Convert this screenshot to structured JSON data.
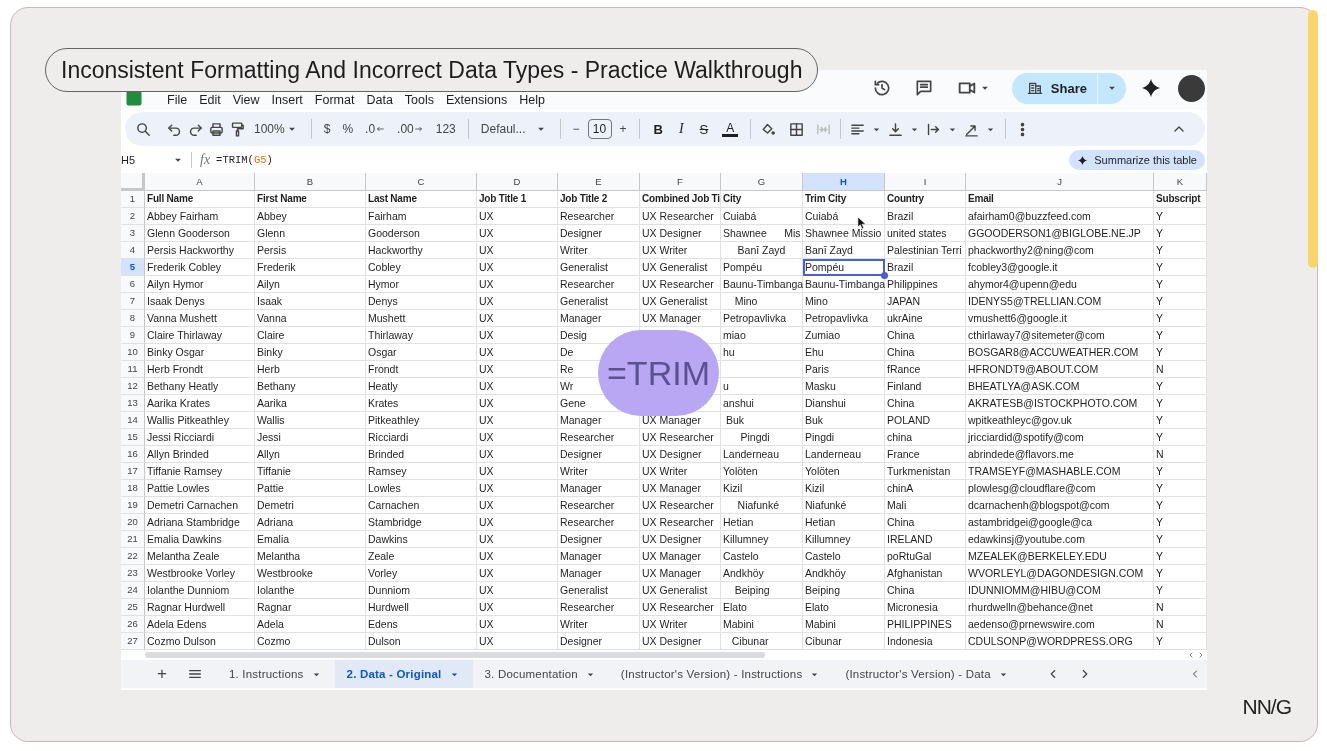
{
  "video_title": "Inconsistent Formatting And Incorrect Data Types - Practice Walkthrough",
  "menu": [
    "File",
    "Edit",
    "View",
    "Insert",
    "Format",
    "Data",
    "Tools",
    "Extensions",
    "Help"
  ],
  "share_button": "Share",
  "toolbar": {
    "zoom": "100%",
    "currency": "$",
    "percent": "%",
    "decrease_decimal": ".0",
    "increase_decimal": ".00",
    "number_format": "123",
    "font": "Defaul...",
    "minus": "−",
    "font_size": "10",
    "plus": "+",
    "bold": "B",
    "italic": "I",
    "strikethrough": "S",
    "text_color": "A"
  },
  "formula_bar": {
    "cell_ref": "H5",
    "fx": "fx",
    "formula": [
      {
        "text": "=TRIM(",
        "kind": "text"
      },
      {
        "text": "G5",
        "kind": "ref"
      },
      {
        "text": ")",
        "kind": "text"
      }
    ]
  },
  "summarize_button": "Summarize this table",
  "grid": {
    "columns": [
      {
        "letter": "A",
        "selected": false
      },
      {
        "letter": "B",
        "selected": false
      },
      {
        "letter": "C",
        "selected": false
      },
      {
        "letter": "D",
        "selected": false
      },
      {
        "letter": "E",
        "selected": false
      },
      {
        "letter": "F",
        "selected": false
      },
      {
        "letter": "G",
        "selected": false
      },
      {
        "letter": "H",
        "selected": true
      },
      {
        "letter": "I",
        "selected": false
      },
      {
        "letter": "J",
        "selected": false
      },
      {
        "letter": "K",
        "selected": false
      }
    ],
    "rows": [
      {
        "number": "1",
        "kind": "header",
        "selected": false,
        "cells": [
          "Full Name",
          "First Name",
          "Last Name",
          "Job Title 1",
          "Job Title 2",
          "Combined Job Ti",
          "City",
          "Trim City",
          "Country",
          "Email",
          "Subscript"
        ]
      },
      {
        "number": "2",
        "kind": "data",
        "selected": false,
        "cells": [
          "Abbey Fairham",
          "Abbey",
          "Fairham",
          "UX",
          "Researcher",
          "UX Researcher",
          "Cuiabá",
          "Cuiabá",
          "Brazil",
          "afairham0@buzzfeed.com",
          "Y"
        ]
      },
      {
        "number": "3",
        "kind": "data",
        "selected": false,
        "cells": [
          "Glenn Gooderson",
          "Glenn",
          "Gooderson",
          "UX",
          "Designer",
          "UX Designer",
          "Shawnee      Mis",
          "Shawnee Missio",
          "united states",
          "GGOODERSON1@BIGLOBE.NE.JP",
          "Y"
        ]
      },
      {
        "number": "4",
        "kind": "data",
        "selected": false,
        "cells": [
          "Persis Hackworthy",
          "Persis",
          "Hackworthy",
          "UX",
          "Writer",
          "UX Writer",
          "     Banī Zayd",
          "Banī Zayd",
          "Palestinian Terri",
          "phackworthy2@ning@com",
          "Y"
        ]
      },
      {
        "number": "5",
        "kind": "data",
        "selected": true,
        "cells": [
          "Frederik Cobley",
          "Frederik",
          "Cobley",
          "UX",
          "Generalist",
          "UX Generalist",
          "Pompéu",
          "Pompéu",
          "Brazil",
          "fcobley3@google.it",
          "Y"
        ]
      },
      {
        "number": "6",
        "kind": "data",
        "selected": false,
        "cells": [
          "Ailyn Hymor",
          "Ailyn",
          "Hymor",
          "UX",
          "Researcher",
          "UX Researcher",
          "Baunu-Timbanga",
          "Baunu-Timbanga",
          "Philippines",
          "ahymor4@upenn@edu",
          "Y"
        ]
      },
      {
        "number": "7",
        "kind": "data",
        "selected": false,
        "cells": [
          "Isaak Denys",
          "Isaak",
          "Denys",
          "UX",
          "Generalist",
          "UX Generalist",
          "    Mino",
          "Mino",
          "JAPAN",
          "IDENYS5@TRELLIAN.COM",
          "Y"
        ]
      },
      {
        "number": "8",
        "kind": "data",
        "selected": false,
        "cells": [
          "Vanna Mushett",
          "Vanna",
          "Mushett",
          "UX",
          "Manager",
          "UX Manager",
          "Petropavlivka",
          "Petropavlivka",
          "ukrAine",
          "vmushett6@google.it",
          "Y"
        ]
      },
      {
        "number": "9",
        "kind": "data",
        "selected": false,
        "cells": [
          "Claire Thirlaway",
          "Claire",
          "Thirlaway",
          "UX",
          "Desig",
          null,
          "miao",
          "Zumiao",
          "China",
          "cthirlaway7@sitemeter@com",
          "Y"
        ]
      },
      {
        "number": "10",
        "kind": "data",
        "selected": false,
        "cells": [
          "Binky Osgar",
          "Binky",
          "Osgar",
          "UX",
          "De",
          null,
          "hu",
          "Ehu",
          "China",
          "BOSGAR8@ACCUWEATHER.COM",
          "Y"
        ]
      },
      {
        "number": "11",
        "kind": "data",
        "selected": false,
        "cells": [
          "Herb Frondt",
          "Herb",
          "Frondt",
          "UX",
          "Re",
          null,
          null,
          "Paris",
          "fRance",
          "HFRONDT9@ABOUT.COM",
          "N"
        ]
      },
      {
        "number": "12",
        "kind": "data",
        "selected": false,
        "cells": [
          "Bethany Heatly",
          "Bethany",
          "Heatly",
          "UX",
          "Wr",
          null,
          "u",
          "Masku",
          "Finland",
          "BHEATLYA@ASK.COM",
          "Y"
        ]
      },
      {
        "number": "13",
        "kind": "data",
        "selected": false,
        "cells": [
          "Aarika Krates",
          "Aarika",
          "Krates",
          "UX",
          "Gene",
          null,
          "anshui",
          "Dianshui",
          "China",
          "AKRATESB@ISTOCKPHOTO.COM",
          "Y"
        ]
      },
      {
        "number": "14",
        "kind": "data",
        "selected": false,
        "cells": [
          "Wallis Pitkeathley",
          "Wallis",
          "Pitkeathley",
          "UX",
          "Manager",
          "UX Manager",
          " Buk",
          "Buk",
          "POLAND",
          "wpitkeathleyc@gov.uk",
          "Y"
        ]
      },
      {
        "number": "15",
        "kind": "data",
        "selected": false,
        "cells": [
          "Jessi Ricciardi",
          "Jessi",
          "Ricciardi",
          "UX",
          "Researcher",
          "UX Researcher",
          "      Pingdi",
          "Pingdi",
          "china",
          "jricciardid@spotify@com",
          "Y"
        ]
      },
      {
        "number": "16",
        "kind": "data",
        "selected": false,
        "cells": [
          "Allyn Brinded",
          "Allyn",
          "Brinded",
          "UX",
          "Designer",
          "UX Designer",
          "Landerneau",
          "Landerneau",
          "France",
          "abrindede@flavors.me",
          "N"
        ]
      },
      {
        "number": "17",
        "kind": "data",
        "selected": false,
        "cells": [
          "Tiffanie Ramsey",
          "Tiffanie",
          "Ramsey",
          "UX",
          "Writer",
          "UX Writer",
          "Yolöten",
          "Yolöten",
          "Turkmenistan",
          "TRAMSEYF@MASHABLE.COM",
          "Y"
        ]
      },
      {
        "number": "18",
        "kind": "data",
        "selected": false,
        "cells": [
          "Pattie Lowles",
          "Pattie",
          "Lowles",
          "UX",
          "Manager",
          "UX Manager",
          "Kizil",
          "Kizil",
          "chinA",
          "plowlesg@cloudflare@com",
          "Y"
        ]
      },
      {
        "number": "19",
        "kind": "data",
        "selected": false,
        "cells": [
          "Demetri Carnachen",
          "Demetri",
          "Carnachen",
          "UX",
          "Researcher",
          "UX Researcher",
          "     Niafunké",
          "Niafunké",
          "Mali",
          "dcarnachenh@blogspot@com",
          "Y"
        ]
      },
      {
        "number": "20",
        "kind": "data",
        "selected": false,
        "cells": [
          "Adriana Stambridge",
          "Adriana",
          "Stambridge",
          "UX",
          "Researcher",
          "UX Researcher",
          "Hetian",
          "Hetian",
          "China",
          "astambridgei@google@ca",
          "Y"
        ]
      },
      {
        "number": "21",
        "kind": "data",
        "selected": false,
        "cells": [
          "Emalia Dawkins",
          "Emalia",
          "Dawkins",
          "UX",
          "Designer",
          "UX Designer",
          "Killumney",
          "Killumney",
          "IRELAND",
          "edawkinsj@youtube.com",
          "Y"
        ]
      },
      {
        "number": "22",
        "kind": "data",
        "selected": false,
        "cells": [
          "Melantha Zeale",
          "Melantha",
          "Zeale",
          "UX",
          "Manager",
          "UX Manager",
          "Castelo",
          "Castelo",
          "poRtuGal",
          "MZEALEK@BERKELEY.EDU",
          "Y"
        ]
      },
      {
        "number": "23",
        "kind": "data",
        "selected": false,
        "cells": [
          "Westbrooke Vorley",
          "Westbrooke",
          "Vorley",
          "UX",
          "Manager",
          "UX Manager",
          "Andkhöy",
          "Andkhöy",
          "Afghanistan",
          "WVORLEYL@DAGONDESIGN.COM",
          "Y"
        ]
      },
      {
        "number": "24",
        "kind": "data",
        "selected": false,
        "cells": [
          "Iolanthe Dunniom",
          "Iolanthe",
          "Dunniom",
          "UX",
          "Generalist",
          "UX Generalist",
          "    Beiping",
          "Beiping",
          "China",
          "IDUNNIOMM@HIBU@COM",
          "Y"
        ]
      },
      {
        "number": "25",
        "kind": "data",
        "selected": false,
        "cells": [
          "Ragnar Hurdwell",
          "Ragnar",
          "Hurdwell",
          "UX",
          "Researcher",
          "UX Researcher",
          "Elato",
          "Elato",
          "Micronesia",
          "rhurdwelln@behance@net",
          "N"
        ]
      },
      {
        "number": "26",
        "kind": "data",
        "selected": false,
        "cells": [
          "Adela Edens",
          "Adela",
          "Edens",
          "UX",
          "Writer",
          "UX Writer",
          "Mabini",
          "Mabini",
          "PHILIPPINES",
          "aedenso@prnewswire.com",
          "N"
        ]
      },
      {
        "number": "27",
        "kind": "data",
        "selected": false,
        "cells": [
          "Cozmo Dulson",
          "Cozmo",
          "Dulson",
          "UX",
          "Designer",
          "UX Designer",
          "   Cibunar",
          "Cibunar",
          "Indonesia",
          "CDULSONP@WORDPRESS.ORG",
          "Y"
        ]
      }
    ]
  },
  "overlay_label": "=TRIM",
  "sheet_tabs": [
    {
      "label": "1. Instructions",
      "selected": false
    },
    {
      "label": "2. Data - Original",
      "selected": true
    },
    {
      "label": "3. Documentation",
      "selected": false
    },
    {
      "label": "(Instructor's Version) - Instructions",
      "selected": false
    },
    {
      "label": "(Instructor's Version) - Data",
      "selected": false
    }
  ],
  "add_sheet": "+",
  "logo": "NN/G"
}
